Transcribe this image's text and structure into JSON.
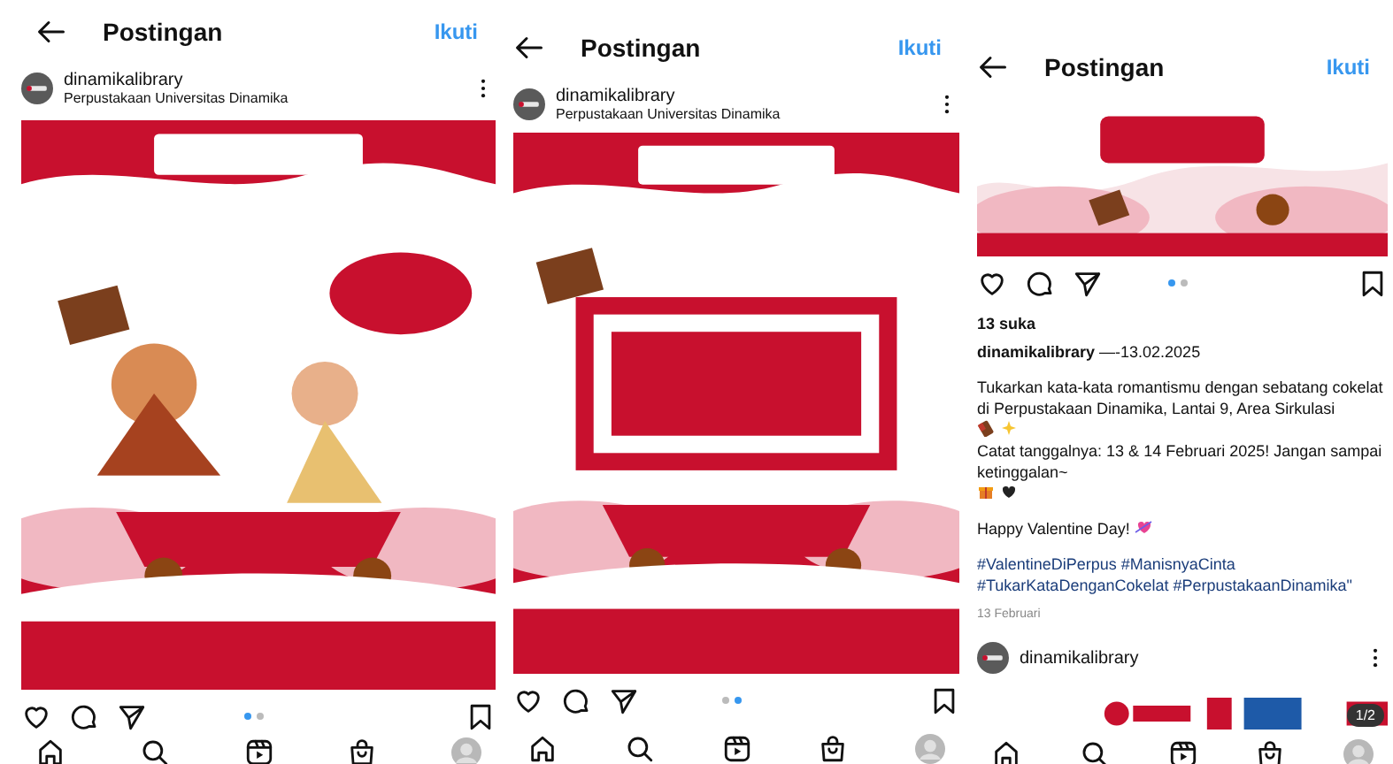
{
  "panels": [
    {
      "header": {
        "title": "Postingan",
        "action": "Ikuti"
      },
      "post": {
        "account": "dinamikalibrary",
        "location": "Perpustakaan Universitas Dinamika",
        "carousel": [
          {
            "selected": true
          },
          {
            "selected": false
          }
        ]
      }
    },
    {
      "header": {
        "title": "Postingan",
        "action": "Ikuti"
      },
      "post": {
        "account": "dinamikalibrary",
        "location": "Perpustakaan Universitas Dinamika",
        "carousel": [
          {
            "selected": false
          },
          {
            "selected": true
          }
        ]
      }
    },
    {
      "header": {
        "title": "Postingan",
        "action": "Ikuti"
      },
      "post": {
        "carousel": [
          {
            "selected": true
          },
          {
            "selected": false
          }
        ],
        "likes": "13 suka",
        "byline": "**dinamikalibrary** —-13.02.2025",
        "caption": [
          {
            "parts": [
              {
                "kind": "text",
                "text": "Tukarkan kata-kata romantismu dengan sebatang cokelat di Perpustakaan Dinamika, Lantai 9, Area Sirkulasi"
              },
              {
                "kind": "chocolate"
              },
              {
                "kind": "sparkle"
              },
              {
                "kind": "text",
                "text": "Catat tanggalnya: 13 & 14 Februari 2025! Jangan sampai ketinggalan~"
              },
              {
                "kind": "gift"
              },
              {
                "kind": "heart"
              }
            ]
          },
          {
            "parts": [
              {
                "kind": "text",
                "text": "Happy Valentine Day!"
              },
              {
                "kind": "heart-arrow"
              }
            ]
          }
        ],
        "hashtags": "#ValentineDiPerpus #ManisnyaCinta #TukarKataDenganCokelat #PerpustakaanDinamika\"",
        "date": "13 Februari"
      },
      "next_post": {
        "account": "dinamikalibrary",
        "counter": "1/2"
      }
    }
  ]
}
